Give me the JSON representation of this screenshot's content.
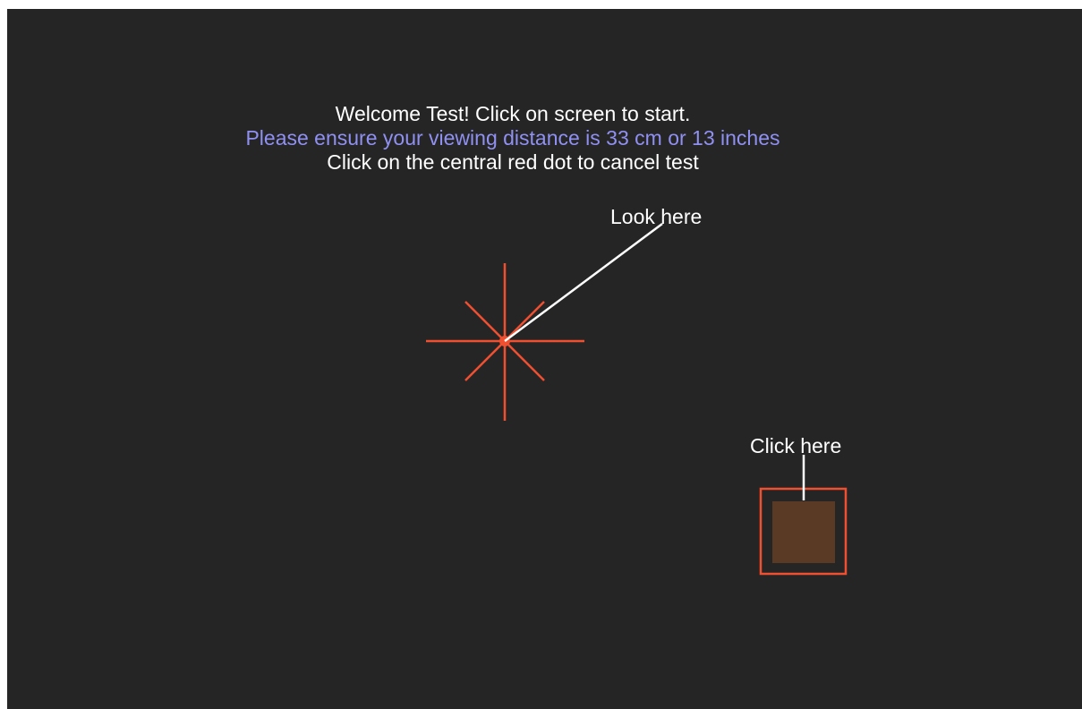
{
  "intro": {
    "welcome": "Welcome Test! Click on screen to start.",
    "distance_notice": "Please ensure your viewing distance is 33 cm or 13 inches",
    "cancel_hint": "Click on the central red dot to cancel test"
  },
  "fixation": {
    "callout_label": "Look here"
  },
  "start_target": {
    "callout_label": "Click here"
  },
  "colors": {
    "background": "#252525",
    "fixation": "#f05030",
    "distance_notice": "#9090f2",
    "target_fill": "#5a3a24",
    "text": "#ffffff"
  }
}
